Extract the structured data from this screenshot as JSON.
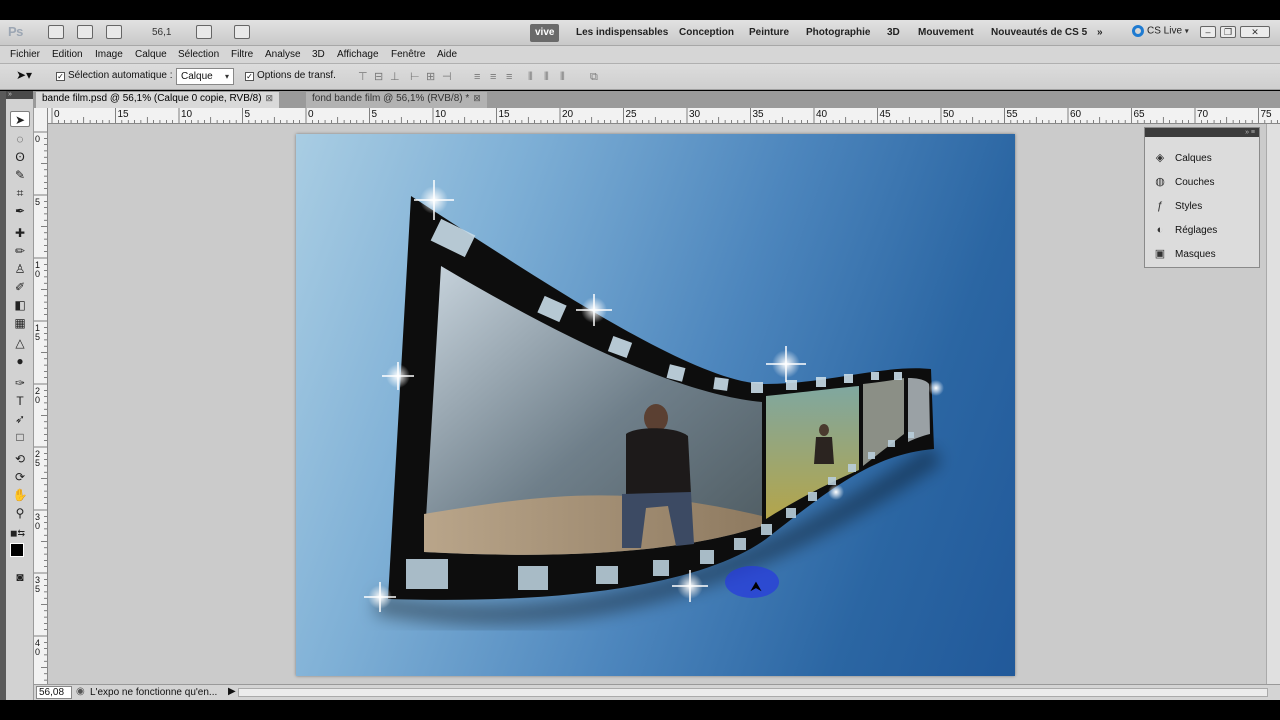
{
  "app": {
    "logo": "Ps"
  },
  "appbar": {
    "zoom": "56,1",
    "workspaces": [
      "vive",
      "Les indispensables",
      "Conception",
      "Peinture",
      "Photographie",
      "3D",
      "Mouvement",
      "Nouveautés de CS 5"
    ],
    "more": "»",
    "cslive": "CS Live"
  },
  "menu": [
    "Fichier",
    "Edition",
    "Image",
    "Calque",
    "Sélection",
    "Filtre",
    "Analyse",
    "3D",
    "Affichage",
    "Fenêtre",
    "Aide"
  ],
  "options": {
    "auto_select_label": "Sélection automatique :",
    "auto_select_value": "Calque",
    "transform_label": "Options de transf."
  },
  "tabs": [
    {
      "label": "bande film.psd @ 56,1% (Calque 0 copie, RVB/8)",
      "active": true
    },
    {
      "label": "fond bande film @ 56,1% (RVB/8) *",
      "active": false
    }
  ],
  "ruler_h": [
    "0",
    "15",
    "10",
    "5",
    "0",
    "5",
    "10",
    "15",
    "20",
    "25",
    "30",
    "35",
    "40",
    "45",
    "50",
    "55",
    "60",
    "65",
    "70",
    "75"
  ],
  "ruler_v": [
    "0",
    "5",
    "10",
    "15",
    "20",
    "25",
    "30",
    "35",
    "40"
  ],
  "panel": {
    "items": [
      {
        "label": "Calques",
        "icon": "layers-icon"
      },
      {
        "label": "Couches",
        "icon": "channels-icon"
      },
      {
        "label": "Styles",
        "icon": "styles-icon"
      },
      {
        "label": "Réglages",
        "icon": "adjustments-icon"
      },
      {
        "label": "Masques",
        "icon": "masks-icon"
      }
    ]
  },
  "status": {
    "zoom": "56,08",
    "message": "L'expo ne fonctionne qu'en..."
  },
  "colors": {
    "canvas_light": "#a9cde3",
    "canvas_dark": "#21599a",
    "highlight": "#2a3cdc"
  }
}
